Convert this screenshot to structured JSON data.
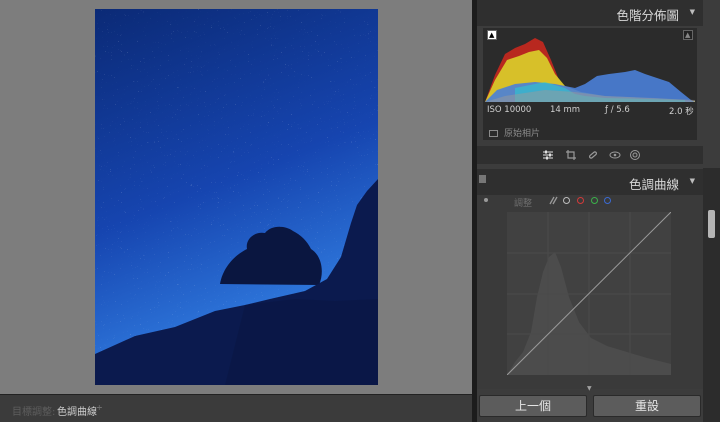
{
  "bottom_bar": {
    "target_label": "目標調整:",
    "target_value": "色調曲線",
    "target_arrow": "÷"
  },
  "histogram": {
    "title": "色階分佈圖",
    "exif": {
      "iso": "ISO 10000",
      "focal": "14 mm",
      "aperture": "ƒ / 5.6",
      "shutter": "2.0 秒"
    },
    "original_photo_label": "原始相片"
  },
  "tool_strip": {
    "icons": [
      "sliders-icon",
      "crop-icon",
      "heal-brush-icon",
      "red-eye-icon",
      "radial-filter-icon"
    ]
  },
  "tone_curve": {
    "title": "色調曲線",
    "adjust_label": "調整",
    "channel_colors": {
      "rgb": "#bdbdbd",
      "red": "#d23a3a",
      "green": "#3ab04a",
      "blue": "#3a6ad2"
    }
  },
  "buttons": {
    "previous": "上一個",
    "reset": "重設"
  },
  "colors": {
    "canvas_bg": "#7d7d7d",
    "panel_bg": "#3c3c3c",
    "sky_top": "#0a2a78",
    "sky_bottom": "#2f7ae0"
  }
}
